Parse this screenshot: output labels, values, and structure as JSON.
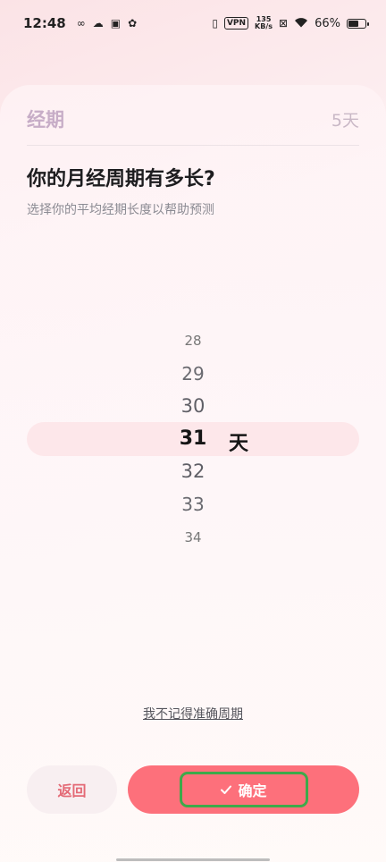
{
  "status_bar": {
    "time": "12:48",
    "vpn": "VPN",
    "net_speed_value": "135",
    "net_speed_unit": "KB/s",
    "battery": "66%",
    "battery_level": 0.66
  },
  "header": {
    "phase_label": "经期",
    "phase_days": "5天"
  },
  "question": {
    "title": "你的月经周期有多长?",
    "subtitle": "选择你的平均经期长度以帮助预测"
  },
  "picker": {
    "values": [
      "28",
      "29",
      "30",
      "31",
      "32",
      "33",
      "34"
    ],
    "selected": "31",
    "unit": "天"
  },
  "forgot_link": "我不记得准确周期",
  "buttons": {
    "back": "返回",
    "confirm": "确定"
  },
  "colors": {
    "accent": "#fd707b",
    "highlight": "#fde7ea",
    "focus_ring": "#3ea94a"
  }
}
